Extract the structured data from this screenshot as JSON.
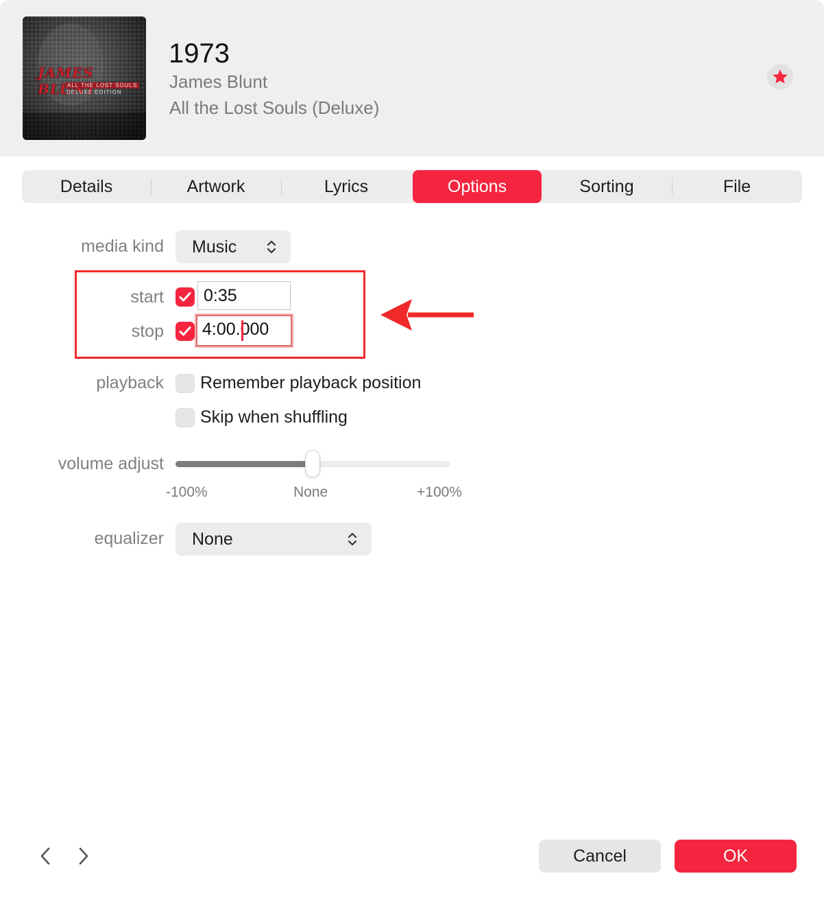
{
  "header": {
    "title": "1973",
    "artist": "James Blunt",
    "album": "All the Lost Souls (Deluxe)",
    "artwork": {
      "brand": "JAMES BLUNT",
      "subtitle": "ALL THE LOST SOULS",
      "edition": "DELUXE EDITION"
    },
    "love_icon": "star-icon"
  },
  "tabs": [
    {
      "label": "Details",
      "active": false
    },
    {
      "label": "Artwork",
      "active": false
    },
    {
      "label": "Lyrics",
      "active": false
    },
    {
      "label": "Options",
      "active": true
    },
    {
      "label": "Sorting",
      "active": false
    },
    {
      "label": "File",
      "active": false
    }
  ],
  "options": {
    "media_kind": {
      "label": "media kind",
      "value": "Music"
    },
    "start": {
      "label": "start",
      "checked": true,
      "value": "0:35"
    },
    "stop": {
      "label": "stop",
      "checked": true,
      "value": "4:00.000"
    },
    "playback": {
      "label": "playback",
      "remember": {
        "label": "Remember playback position",
        "checked": false
      },
      "skip": {
        "label": "Skip when shuffling",
        "checked": false
      }
    },
    "volume": {
      "label": "volume adjust",
      "value_percent": 0,
      "min_label": "-100%",
      "mid_label": "None",
      "max_label": "+100%"
    },
    "equalizer": {
      "label": "equalizer",
      "value": "None"
    }
  },
  "footer": {
    "cancel_label": "Cancel",
    "ok_label": "OK"
  },
  "colors": {
    "accent": "#f5253f",
    "annotation": "#f0292a"
  }
}
